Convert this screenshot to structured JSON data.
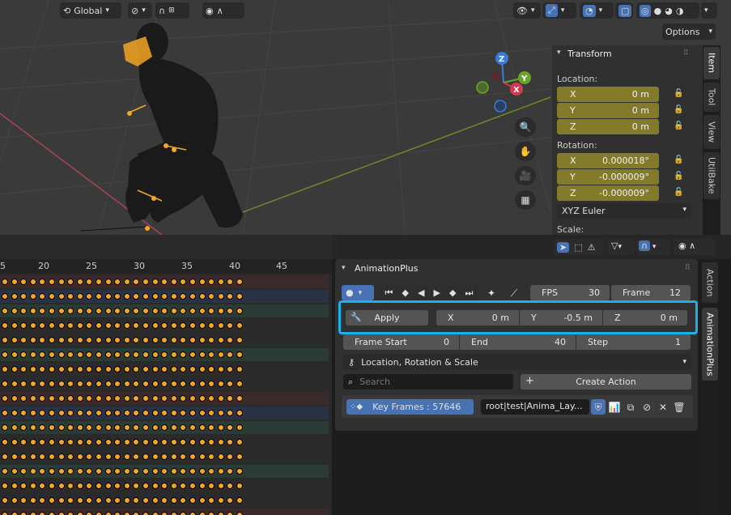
{
  "header": {
    "orientation_label": "Global",
    "options_label": "Options"
  },
  "npanel": {
    "title": "Transform",
    "location_label": "Location:",
    "rotation_label": "Rotation:",
    "scale_label": "Scale:",
    "location": [
      {
        "axis": "X",
        "value": "0 m"
      },
      {
        "axis": "Y",
        "value": "0 m"
      },
      {
        "axis": "Z",
        "value": "0 m"
      }
    ],
    "rotation": [
      {
        "axis": "X",
        "value": "0.000018°"
      },
      {
        "axis": "Y",
        "value": "-0.000009°"
      },
      {
        "axis": "Z",
        "value": "-0.000009°"
      }
    ],
    "rotation_mode": "XYZ Euler",
    "tabs": [
      "Item",
      "Tool",
      "View",
      "UtilBake"
    ]
  },
  "gizmo": {
    "x": "X",
    "y": "Y",
    "z": "Z"
  },
  "timeline": {
    "frames": [
      "5",
      "20",
      "25",
      "30",
      "35",
      "40",
      "45"
    ]
  },
  "animplus": {
    "title": "AnimationPlus",
    "fps_label": "FPS",
    "fps_value": "30",
    "frame_label": "Frame",
    "frame_value": "12",
    "apply_label": "Apply",
    "offset": [
      {
        "axis": "X",
        "value": "0 m"
      },
      {
        "axis": "Y",
        "value": "-0.5 m"
      },
      {
        "axis": "Z",
        "value": "0 m"
      }
    ],
    "frame_start_label": "Frame Start",
    "frame_start_value": "0",
    "end_label": "End",
    "end_value": "40",
    "step_label": "Step",
    "step_value": "1",
    "keying_set": "Location, Rotation & Scale",
    "search_placeholder": "Search",
    "create_action_label": "Create Action",
    "keyframes_label": "Key Frames : 57646",
    "action_name": "root|test|Anima_Lay..."
  },
  "side_tabs": [
    "Action",
    "AnimationPlus"
  ],
  "colors": {
    "highlight": "#1ab0e8",
    "field_gold": "#847b2a",
    "keyframe": "#f5a623",
    "selected_blue": "#4772b3"
  }
}
